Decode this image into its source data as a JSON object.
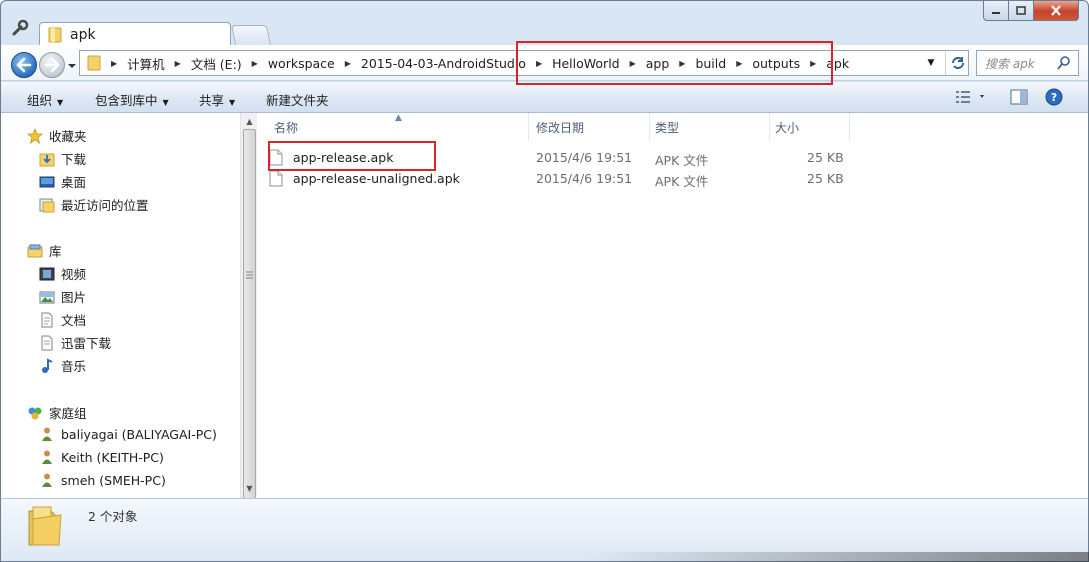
{
  "window": {
    "tab_title": "apk"
  },
  "address": {
    "segments": [
      "计算机",
      "文档 (E:)",
      "workspace",
      "2015-04-03-AndroidStudio",
      "HelloWorld",
      "app",
      "build",
      "outputs",
      "apk"
    ],
    "search_placeholder": "搜索 apk"
  },
  "toolbar": {
    "organize": "组织",
    "include_in_library": "包含到库中",
    "share": "共享",
    "new_folder": "新建文件夹"
  },
  "nav": {
    "favorites": {
      "header": "收藏夹",
      "items": [
        "下载",
        "桌面",
        "最近访问的位置"
      ]
    },
    "libraries": {
      "header": "库",
      "items": [
        "视频",
        "图片",
        "文档",
        "迅雷下载",
        "音乐"
      ]
    },
    "homegroup": {
      "header": "家庭组",
      "items": [
        "baliyagai (BALIYAGAI-PC)",
        "Keith (KEITH-PC)",
        "smeh (SMEH-PC)"
      ]
    }
  },
  "columns": {
    "name": "名称",
    "modified": "修改日期",
    "type": "类型",
    "size": "大小"
  },
  "files": [
    {
      "name": "app-release.apk",
      "modified": "2015/4/6 19:51",
      "type": "APK 文件",
      "size": "25 KB"
    },
    {
      "name": "app-release-unaligned.apk",
      "modified": "2015/4/6 19:51",
      "type": "APK 文件",
      "size": "25 KB"
    }
  ],
  "status": {
    "count_text": "2 个对象"
  },
  "colors": {
    "highlight_red": "#d5262a",
    "window_blue": "#c9daee"
  }
}
